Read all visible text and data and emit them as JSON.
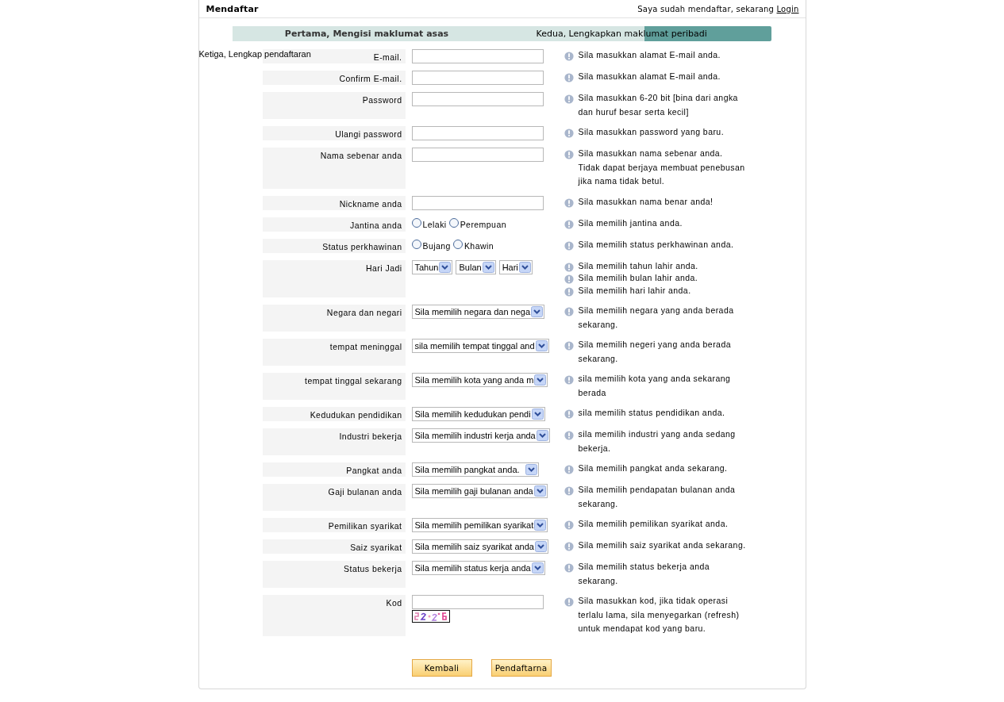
{
  "header": {
    "title": "Mendaftar",
    "login_prompt": "Saya sudah mendaftar, sekarang",
    "login_link": "Login"
  },
  "steps": [
    {
      "label": "Pertama, Mengisi maklumat asas",
      "selected": true
    },
    {
      "label": "Kedua, Lengkapkan maklumat peribadi",
      "selected": false
    },
    {
      "label": "Ketiga, Lengkap pendaftaran",
      "selected": false
    }
  ],
  "rows": [
    {
      "kind": "text",
      "label": "E-mail.",
      "hints": [
        "Sila masukkan alamat E-mail anda."
      ]
    },
    {
      "kind": "text",
      "label": "Confirm E-mail.",
      "hints": [
        "Sila masukkan alamat E-mail anda."
      ]
    },
    {
      "kind": "text",
      "label": "Password",
      "hints": [
        "Sila masukkan 6-20 bit [bina dari angka dan huruf besar serta kecil]"
      ]
    },
    {
      "kind": "text",
      "label": "Ulangi password",
      "hints": [
        "Sila masukkan password yang baru."
      ]
    },
    {
      "kind": "text",
      "label": "Nama sebenar anda",
      "hints": [
        "Sila masukkan nama sebenar anda. Tidak dapat berjaya membuat penebusan jika nama tidak betul."
      ]
    },
    {
      "kind": "text",
      "label": "Nickname anda",
      "hints": [
        "Sila masukkan nama benar anda!"
      ]
    },
    {
      "kind": "radio",
      "label": "Jantina anda",
      "options": [
        {
          "label": "Lelaki",
          "selected": false
        },
        {
          "label": "Perempuan",
          "selected": false
        }
      ],
      "hints": [
        "Sila memilih jantina anda."
      ]
    },
    {
      "kind": "radio",
      "label": "Status perkhawinan",
      "options": [
        {
          "label": "Bujang",
          "selected": false
        },
        {
          "label": "Khawin",
          "selected": false
        }
      ],
      "hints": [
        "Sila memilih status perkhawinan anda."
      ]
    },
    {
      "kind": "date",
      "label": "Hari Jadi",
      "selects": [
        "Tahun",
        "Bulan",
        "Hari"
      ],
      "hints": [
        "Sila memilih tahun lahir anda.",
        "Sila memilih bulan lahir anda.",
        "Sila memilih hari lahir anda."
      ]
    },
    {
      "kind": "select",
      "label": "Negara dan negari",
      "value": "Sila memilih negara dan nega",
      "hints": [
        "Sila memilih negara yang anda berada sekarang."
      ]
    },
    {
      "kind": "select",
      "label": "tempat meninggal",
      "value": "sila memilih tempat tinggal and",
      "hints": [
        "Sila memilih negeri yang anda berada sekarang."
      ]
    },
    {
      "kind": "select",
      "label": "tempat tinggal sekarang",
      "value": "Sila memilih kota yang anda m",
      "hints": [
        "sila memilih kota yang anda sekarang berada"
      ]
    },
    {
      "kind": "select",
      "label": "Kedudukan pendidikan",
      "value": "Sila memilih kedudukan pendi",
      "hints": [
        "sila memilih status pendidikan anda."
      ]
    },
    {
      "kind": "select",
      "label": "Industri bekerja",
      "value": "Sila memilih industri kerja anda",
      "hints": [
        "sila memilih industri yang anda sedang bekerja."
      ]
    },
    {
      "kind": "select",
      "label": "Pangkat anda",
      "value": "Sila memilih pangkat anda.",
      "hints": [
        "Sila memilih pangkat anda sekarang."
      ]
    },
    {
      "kind": "select",
      "label": "Gaji bulanan anda",
      "value": "Sila memilih gaji bulanan anda",
      "hints": [
        "Sila memilih pendapatan bulanan anda sekarang."
      ]
    },
    {
      "kind": "select",
      "label": "Pemilikan syarikat",
      "value": "Sila memilih pemilikan syarikat",
      "hints": [
        "Sila memilih pemilikan syarikat anda."
      ]
    },
    {
      "kind": "select",
      "label": "Saiz syarikat",
      "value": "Sila memilih saiz syarikat anda",
      "hints": [
        "Sila memilih saiz syarikat anda sekarang."
      ]
    },
    {
      "kind": "select",
      "label": "Status bekerja",
      "value": "Sila memilih status kerja anda",
      "hints": [
        "Sila memilih status bekerja anda sekarang."
      ]
    },
    {
      "kind": "code",
      "label": "Kod",
      "captcha": {
        "kind": "picture"
      },
      "hints": [
        "Sila masukkan kod, jika tidak operasi terlalu lama, sila menyegarkan (refresh) untuk mendapat kod yang baru."
      ]
    }
  ],
  "buttons": [
    "Kembali",
    "Pendaftarna"
  ]
}
